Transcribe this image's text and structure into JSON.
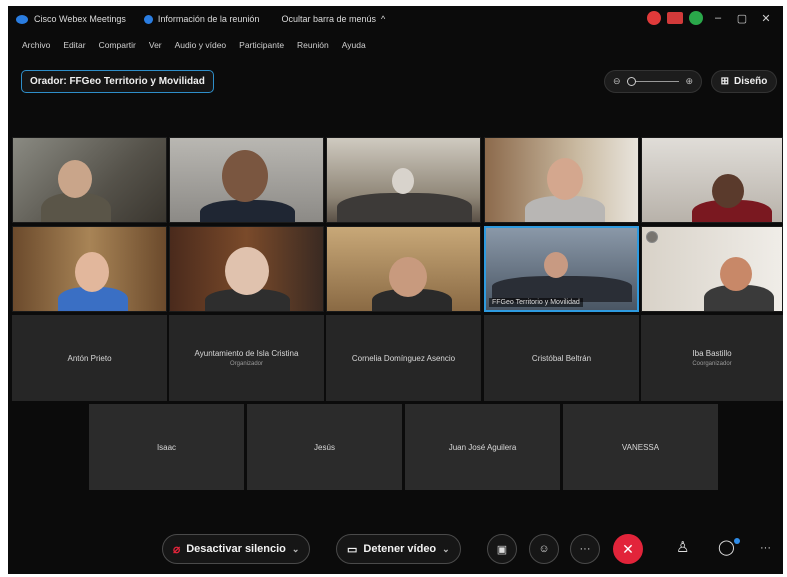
{
  "titlebar": {
    "app_title": "Cisco Webex Meetings",
    "info_label": "Información de la reunión",
    "hide_menu_label": "Ocultar barra de menús"
  },
  "menu": [
    "Archivo",
    "Editar",
    "Compartir",
    "Ver",
    "Audio y vídeo",
    "Participante",
    "Reunión",
    "Ayuda"
  ],
  "host_chip": "Orador: FFGeo Territorio y Movilidad",
  "layout_label": "Diseño",
  "video_tiles": [
    {
      "label": ""
    },
    {
      "label": ""
    },
    {
      "label": ""
    },
    {
      "label": ""
    },
    {
      "label": ""
    },
    {
      "label": ""
    },
    {
      "label": ""
    },
    {
      "label": ""
    },
    {
      "label": "FFGeo Territorio y Movilidad"
    },
    {
      "label": ""
    }
  ],
  "name_tiles_row1": [
    {
      "name": "Antón Prieto",
      "role": ""
    },
    {
      "name": "Ayuntamiento de Isla Cristina",
      "role": "Organizador"
    },
    {
      "name": "Cornelia Domínguez Asencio",
      "role": ""
    },
    {
      "name": "Cristóbal Beltrán",
      "role": ""
    },
    {
      "name": "Iba Bastillo",
      "role": "Coorganizador"
    }
  ],
  "name_tiles_row2": [
    {
      "name": "Isaac"
    },
    {
      "name": "Jesús"
    },
    {
      "name": "Juan José Aguilera"
    },
    {
      "name": "VANESSA"
    }
  ],
  "controls": {
    "mute_label": "Desactivar silencio",
    "video_label": "Detener vídeo"
  },
  "colors": {
    "accent": "#2e8ec9",
    "end_call": "#e2243a",
    "background": "#0b0b0b",
    "name_tile": "#262626"
  }
}
